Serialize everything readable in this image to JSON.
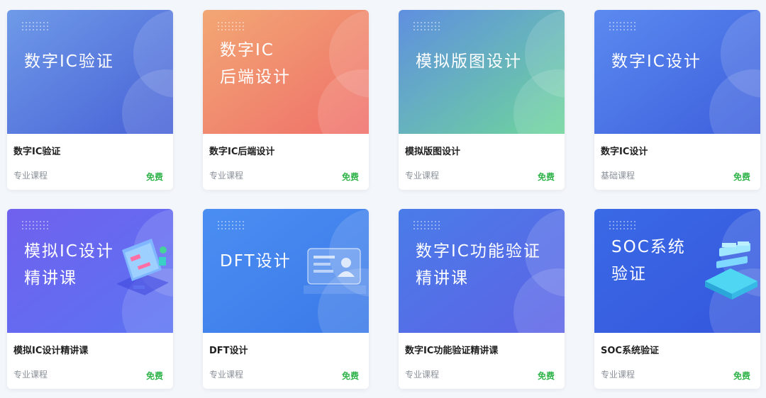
{
  "courses": [
    {
      "banner_title": "数字IC验证",
      "name": "数字IC验证",
      "category": "专业课程",
      "price": "免费",
      "colors": [
        "#6f9ae8",
        "#4761d6"
      ],
      "illustration": null
    },
    {
      "banner_title": "数字IC\n后端设计",
      "name": "数字IC后端设计",
      "category": "专业课程",
      "price": "免费",
      "colors": [
        "#f2a774",
        "#ef6f6a"
      ],
      "illustration": null
    },
    {
      "banner_title": "模拟版图设计",
      "name": "模拟版图设计",
      "category": "专业课程",
      "price": "免费",
      "colors": [
        "#5f8fe0",
        "#6ed69b"
      ],
      "illustration": null
    },
    {
      "banner_title": "数字IC设计",
      "name": "数字IC设计",
      "category": "基础课程",
      "price": "免费",
      "colors": [
        "#5b8af0",
        "#3d5fdc"
      ],
      "illustration": null
    },
    {
      "banner_title": "模拟IC设计\n精讲课",
      "name": "模拟IC设计精讲课",
      "category": "专业课程",
      "price": "免费",
      "colors": [
        "#7061ee",
        "#5b73f2"
      ],
      "illustration": "computer-illustration"
    },
    {
      "banner_title": "DFT设计",
      "name": "DFT设计",
      "category": "专业课程",
      "price": "免费",
      "colors": [
        "#4b8ef2",
        "#3a79e8"
      ],
      "illustration": "id-card-illustration"
    },
    {
      "banner_title": "数字IC功能验证\n精讲课",
      "name": "数字IC功能验证精讲课",
      "category": "专业课程",
      "price": "免费",
      "colors": [
        "#4a7ce8",
        "#5d63e6"
      ],
      "illustration": null
    },
    {
      "banner_title": "SOC系统\n验证",
      "name": "SOC系统验证",
      "category": "专业课程",
      "price": "免费",
      "colors": [
        "#3a6ae6",
        "#3556dc"
      ],
      "illustration": "server-illustration"
    }
  ]
}
